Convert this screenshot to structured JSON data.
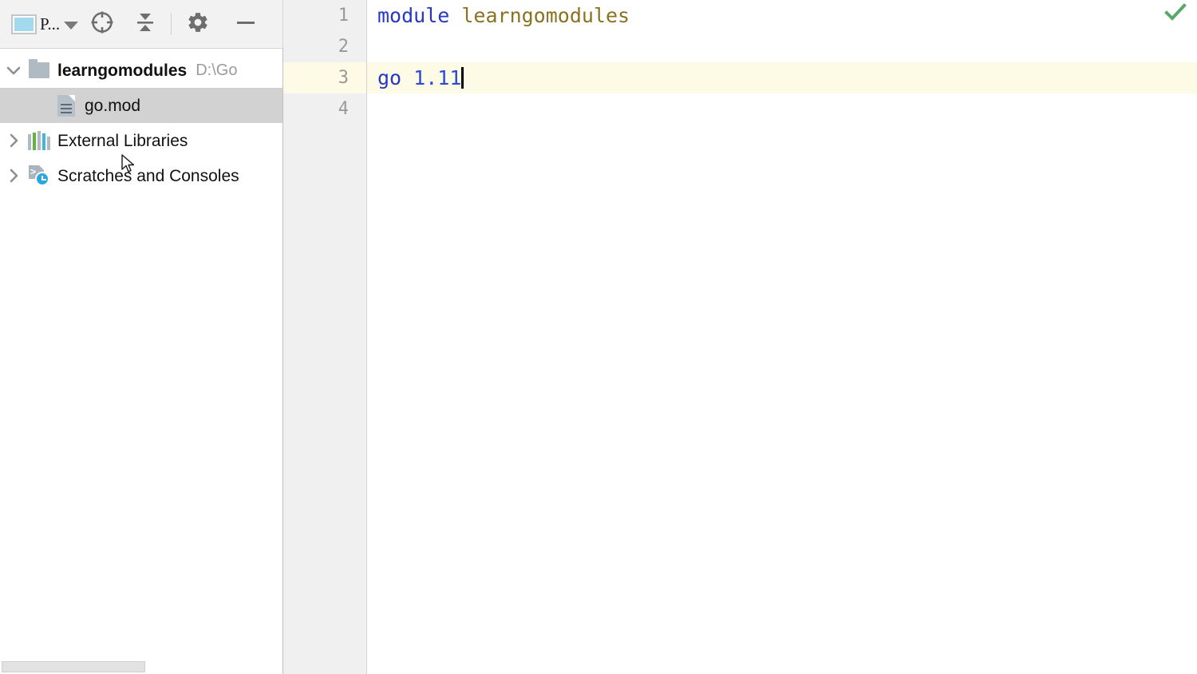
{
  "project_panel": {
    "toolbar": {
      "project_selector_label": "P...",
      "project_selector_icon": "project-window-icon",
      "dropdown_icon": "chevron-down-icon",
      "locate_button_label": "Select Opened File",
      "locate_icon": "crosshair-target-icon",
      "collapse_button_label": "Collapse All",
      "collapse_icon": "collapse-all-icon",
      "settings_button_label": "Settings",
      "settings_icon": "gear-icon",
      "hide_button_label": "Hide",
      "hide_icon": "minimize-dash-icon"
    },
    "tree": [
      {
        "id": "project-root",
        "label": "learngomodules",
        "path": "D:\\Go",
        "icon": "folder-icon",
        "twisty": "expanded",
        "bold": true,
        "selected": false,
        "depth": 0
      },
      {
        "id": "go-mod-file",
        "label": "go.mod",
        "path": "",
        "icon": "file-icon",
        "twisty": "none",
        "bold": false,
        "selected": true,
        "depth": 1
      },
      {
        "id": "external-libraries",
        "label": "External Libraries",
        "path": "",
        "icon": "library-bars-icon",
        "twisty": "collapsed",
        "bold": false,
        "selected": false,
        "depth": 0
      },
      {
        "id": "scratches-and-consoles",
        "label": "Scratches and Consoles",
        "path": "",
        "icon": "scratches-clock-icon",
        "twisty": "collapsed",
        "bold": false,
        "selected": false,
        "depth": 0
      }
    ],
    "horizontal_scrollbar": "panel-hscrollbar"
  },
  "editor": {
    "gutter": {
      "line_numbers": [
        "1",
        "2",
        "3",
        "4"
      ],
      "current_line": 3
    },
    "lines": [
      {
        "number": "1",
        "current": false,
        "tokens": [
          {
            "text": "module",
            "type": "keyword"
          },
          {
            "text": " ",
            "type": "plain"
          },
          {
            "text": "learngomodules",
            "type": "identifier"
          }
        ]
      },
      {
        "number": "2",
        "current": false,
        "tokens": []
      },
      {
        "number": "3",
        "current": true,
        "tokens": [
          {
            "text": "go",
            "type": "keyword"
          },
          {
            "text": " ",
            "type": "plain"
          },
          {
            "text": "1.11",
            "type": "number"
          }
        ],
        "caret_after": true
      },
      {
        "number": "4",
        "current": false,
        "tokens": []
      }
    ],
    "inspection_status": {
      "icon": "green-checkmark-icon",
      "tooltip": "No problems found"
    }
  },
  "colors": {
    "keyword": "#2638c4",
    "identifier": "#8a7320",
    "number": "#2a4bd4",
    "current_line_highlight": "#fdfae6",
    "selection": "#d2d2d2",
    "gutter_bg": "#f0f0f0",
    "toolbar_bg": "#f2f2f2",
    "inspection_ok": "#59a869",
    "library_bar_green": "#62b543",
    "library_bar_cyan": "#40b6e0",
    "library_bar_gray": "#b0bac2",
    "scratch_clock": "#2aa8dd"
  }
}
